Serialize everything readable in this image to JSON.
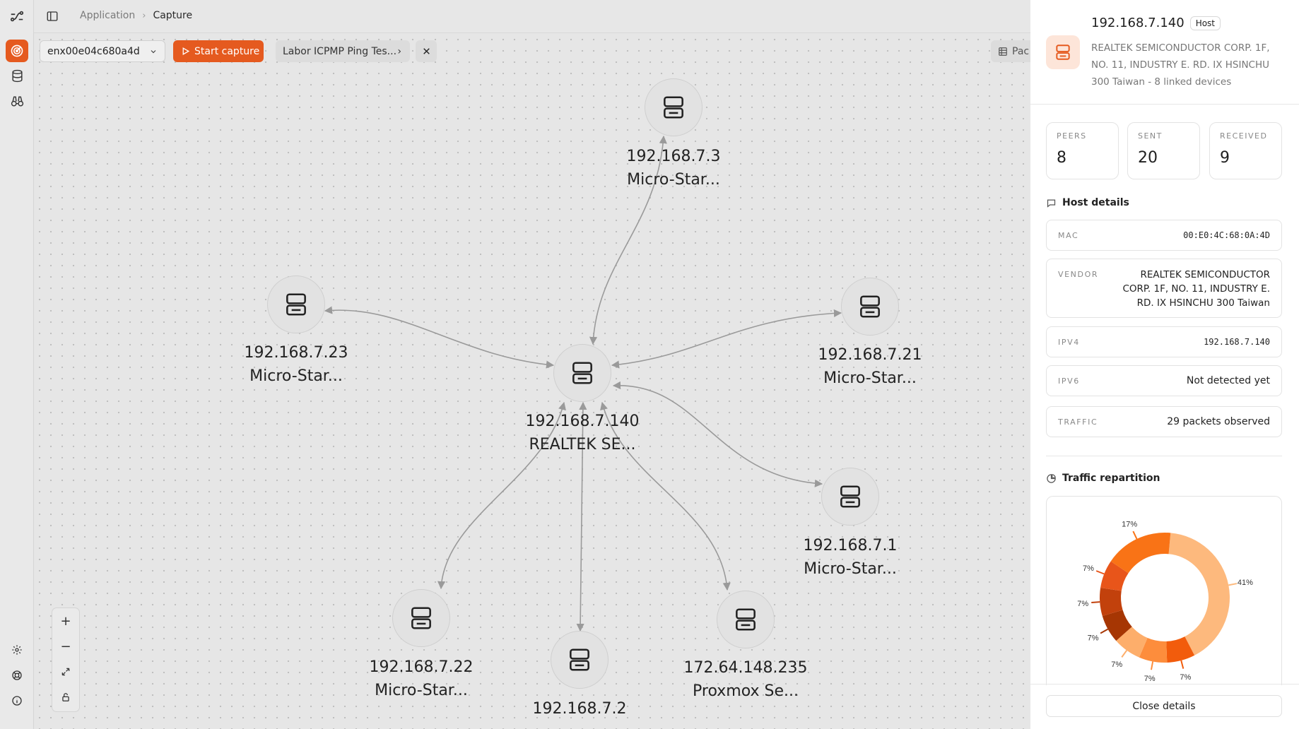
{
  "breadcrumb": {
    "parent": "Application",
    "current": "Capture"
  },
  "toolbar": {
    "interface": "enx00e04c680a4d",
    "start_label": "Start capture",
    "preset_label": "Labor ICPMP Ping Tes...",
    "view_label": "Pac"
  },
  "graph": {
    "nodes": [
      {
        "ip": "192.168.7.3",
        "name": "Micro-Star..."
      },
      {
        "ip": "192.168.7.23",
        "name": "Micro-Star..."
      },
      {
        "ip": "192.168.7.21",
        "name": "Micro-Star..."
      },
      {
        "ip": "192.168.7.140",
        "name": "REALTEK SE..."
      },
      {
        "ip": "192.168.7.1",
        "name": "Micro-Star..."
      },
      {
        "ip": "192.168.7.22",
        "name": "Micro-Star..."
      },
      {
        "ip": "192.168.7.2",
        "name": ""
      },
      {
        "ip": "172.64.148.235",
        "name": "Proxmox Se..."
      }
    ]
  },
  "details": {
    "ip": "192.168.7.140",
    "badge": "Host",
    "subtitle": "REALTEK SEMICONDUCTOR CORP. 1F, NO. 11, INDUSTRY E. RD. IX HSINCHU 300 Taiwan - 8 linked devices",
    "stats": [
      {
        "label": "PEERS",
        "value": "8"
      },
      {
        "label": "SENT",
        "value": "20"
      },
      {
        "label": "RECEIVED",
        "value": "9"
      }
    ],
    "host_section": "Host details",
    "rows": [
      {
        "key": "MAC",
        "value": "00:E0:4C:68:0A:4D"
      },
      {
        "key": "VENDOR",
        "value": "REALTEK SEMICONDUCTOR CORP. 1F, NO. 11, INDUSTRY E. RD. IX HSINCHU 300 Taiwan"
      },
      {
        "key": "IPV4",
        "value": "192.168.7.140"
      },
      {
        "key": "IPV6",
        "value": "Not detected yet"
      },
      {
        "key": "TRAFFIC",
        "value": "29 packets observed"
      }
    ],
    "traffic_section": "Traffic repartition",
    "close_label": "Close details"
  },
  "chart_data": {
    "type": "pie",
    "donut": true,
    "slice_percents": [
      41,
      7,
      7,
      7,
      7,
      7,
      7,
      17
    ],
    "data_labels": [
      "41%",
      "7%",
      "7%",
      "7%",
      "7%",
      "7%",
      "7%",
      "17%"
    ],
    "colors": [
      "#fdb97d",
      "#f25c0c",
      "#fd8d3c",
      "#fdae6b",
      "#a63603",
      "#c2410c",
      "#e8551a",
      "#f97316"
    ]
  },
  "colors": {
    "accent": "#e55a1f",
    "edge": "#9a9a9a"
  }
}
